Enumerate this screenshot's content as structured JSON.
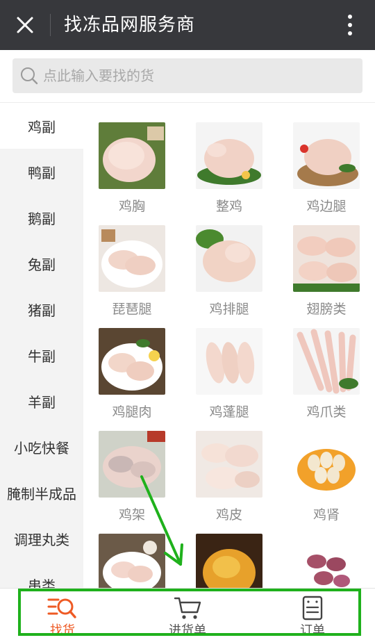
{
  "header": {
    "title": "找冻品网服务商",
    "close_icon": "close-icon",
    "more_icon": "more-vertical-icon"
  },
  "search": {
    "placeholder": "点此输入要找的货",
    "icon": "search-icon"
  },
  "sidebar": {
    "items": [
      {
        "label": "鸡副",
        "active": true
      },
      {
        "label": "鸭副"
      },
      {
        "label": "鹅副"
      },
      {
        "label": "兔副"
      },
      {
        "label": "猪副"
      },
      {
        "label": "牛副"
      },
      {
        "label": "羊副"
      },
      {
        "label": "小吃快餐"
      },
      {
        "label": "腌制半成品"
      },
      {
        "label": "调理丸类"
      },
      {
        "label": "串类"
      }
    ]
  },
  "products": [
    {
      "label": "鸡胸"
    },
    {
      "label": "整鸡"
    },
    {
      "label": "鸡边腿"
    },
    {
      "label": "琵琶腿"
    },
    {
      "label": "鸡排腿"
    },
    {
      "label": "翅膀类"
    },
    {
      "label": "鸡腿肉"
    },
    {
      "label": "鸡蓬腿"
    },
    {
      "label": "鸡爪类"
    },
    {
      "label": "鸡架"
    },
    {
      "label": "鸡皮"
    },
    {
      "label": "鸡肾"
    },
    {
      "label": ""
    },
    {
      "label": ""
    },
    {
      "label": ""
    }
  ],
  "tabs": [
    {
      "label": "找货",
      "icon": "find-goods-icon",
      "active": true
    },
    {
      "label": "进货单",
      "icon": "cart-icon"
    },
    {
      "label": "订单",
      "icon": "order-icon"
    }
  ],
  "colors": {
    "titlebar": "#37383c",
    "accent": "#ee5a24",
    "annotation": "#1fb11c"
  }
}
